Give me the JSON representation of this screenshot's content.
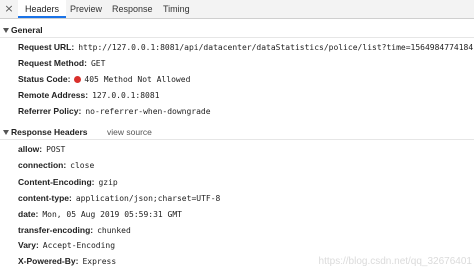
{
  "tabs": {
    "close_glyph": "×",
    "items": [
      {
        "label": "Headers",
        "active": true
      },
      {
        "label": "Preview",
        "active": false
      },
      {
        "label": "Response",
        "active": false
      },
      {
        "label": "Timing",
        "active": false
      }
    ]
  },
  "general": {
    "title": "General",
    "request_url": {
      "key": "Request URL:",
      "value": "http://127.0.0.1:8081/api/datacenter/dataStatistics/police/list?time=1564984774184"
    },
    "request_method": {
      "key": "Request Method:",
      "value": "GET"
    },
    "status_code": {
      "key": "Status Code:",
      "value": "405 Method Not Allowed",
      "dot_color": "#d9302c"
    },
    "remote_address": {
      "key": "Remote Address:",
      "value": "127.0.0.1:8081"
    },
    "referrer_policy": {
      "key": "Referrer Policy:",
      "value": "no-referrer-when-downgrade"
    }
  },
  "response_headers": {
    "title": "Response Headers",
    "view_source": "view source",
    "items": [
      {
        "key": "allow:",
        "value": "POST"
      },
      {
        "key": "connection:",
        "value": "close"
      },
      {
        "key": "Content-Encoding:",
        "value": "gzip"
      },
      {
        "key": "content-type:",
        "value": "application/json;charset=UTF-8"
      },
      {
        "key": "date:",
        "value": "Mon, 05 Aug 2019 05:59:31 GMT"
      },
      {
        "key": "transfer-encoding:",
        "value": "chunked"
      },
      {
        "key": "Vary:",
        "value": "Accept-Encoding"
      },
      {
        "key": "X-Powered-By:",
        "value": "Express"
      }
    ]
  },
  "watermark": "https://blog.csdn.net/qq_32676401"
}
